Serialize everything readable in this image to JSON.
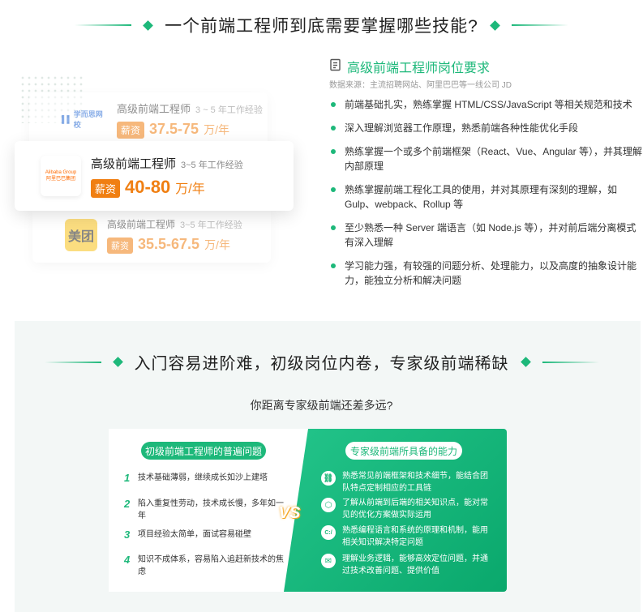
{
  "section1": {
    "title": "一个前端工程师到底需要掌握哪些技能?"
  },
  "cards": [
    {
      "logo_text": "学而思网校",
      "job": "高级前端工程师",
      "exp": "3 ~ 5 年工作经验",
      "tag": "薪资",
      "salary": "37.5-75",
      "unit": "万/年"
    },
    {
      "logo_text": "Alibaba Group 阿里巴巴集团",
      "job": "高级前端工程师",
      "exp": "3~5 年工作经验",
      "tag": "薪资",
      "salary": "40-80",
      "unit": "万/年"
    },
    {
      "logo_text": "美团",
      "job": "高级前端工程师",
      "exp": "3~5 年工作经验",
      "tag": "薪资",
      "salary": "35.5-67.5",
      "unit": "万/年"
    }
  ],
  "requirements": {
    "icon": "document-icon",
    "title": "高级前端工程师岗位要求",
    "source": "数据来源：主流招聘网站、阿里巴巴等一线公司 JD",
    "items": [
      "前端基础扎实，熟练掌握 HTML/CSS/JavaScript 等相关规范和技术",
      "深入理解浏览器工作原理，熟悉前端各种性能优化手段",
      "熟练掌握一个或多个前端框架（React、Vue、Angular 等），并其理解内部原理",
      "熟练掌握前端工程化工具的使用，并对其原理有深刻的理解，如 Gulp、webpack、Rollup 等",
      "至少熟悉一种 Server 端语言（如 Node.js 等），并对前后端分离模式有深入理解",
      "学习能力强，有较强的问题分析、处理能力，以及高度的抽象设计能力，能独立分析和解决问题"
    ]
  },
  "section2": {
    "title": "入门容易进阶难，初级岗位内卷，专家级前端稀缺",
    "subtitle": "你距离专家级前端还差多远?"
  },
  "compare": {
    "left_title": "初级前端工程师的普遍问题",
    "right_title": "专家级前端所具备的能力",
    "vs": "VS",
    "left_items": [
      {
        "num": "1",
        "text": "技术基础薄弱，继续成长如沙上建塔"
      },
      {
        "num": "2",
        "text": "陷入重复性劳动，技术成长慢，多年如一年"
      },
      {
        "num": "3",
        "text": "项目经验太简单，面试容易碰壁"
      },
      {
        "num": "4",
        "text": "知识不成体系，容易陷入追赶新技术的焦虑"
      }
    ],
    "right_items": [
      {
        "icon": "link-icon",
        "glyph": "⛓",
        "text": "熟悉常见前端框架和技术细节，能结合团队特点定制相应的工具链"
      },
      {
        "icon": "cube-icon",
        "glyph": "⬡",
        "text": "了解从前端到后端的相关知识点，能对常见的优化方案做实际运用"
      },
      {
        "icon": "code-icon",
        "glyph": "C:/",
        "text": "熟悉编程语言和系统的原理和机制，能用相关知识解决特定问题"
      },
      {
        "icon": "mail-icon",
        "glyph": "✉",
        "text": "理解业务逻辑，能够高效定位问题，并通过技术改善问题、提供价值"
      }
    ]
  },
  "colors": {
    "accent": "#1db87a",
    "salary": "#f07f12"
  }
}
